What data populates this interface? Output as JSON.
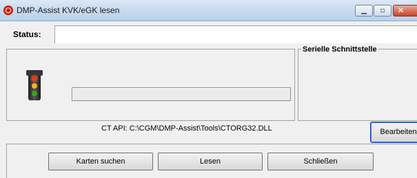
{
  "window": {
    "title": "DMP-Assist KVK/eGK lesen",
    "controls": {
      "minimize_icon": "minimize-icon",
      "maximize_icon": "maximize-icon",
      "close_icon": "close-icon",
      "close_glyph": "✕"
    }
  },
  "status": {
    "label": "Status:",
    "value": ""
  },
  "reader": {
    "traffic_light_icon": "traffic-light-icon",
    "progress": 0
  },
  "serial": {
    "legend": "Serielle Schnittstelle"
  },
  "ct_api": {
    "text": "CT API: C:\\CGM\\DMP-Assist\\Tools\\CTORG32.DLL"
  },
  "buttons": {
    "edit": "Bearbeiten",
    "search_cards": "Karten suchen",
    "read": "Lesen",
    "close": "Schließen"
  },
  "colors": {
    "accent_focus": "#2a3ec0",
    "titlebar": "#c9dcf0"
  }
}
